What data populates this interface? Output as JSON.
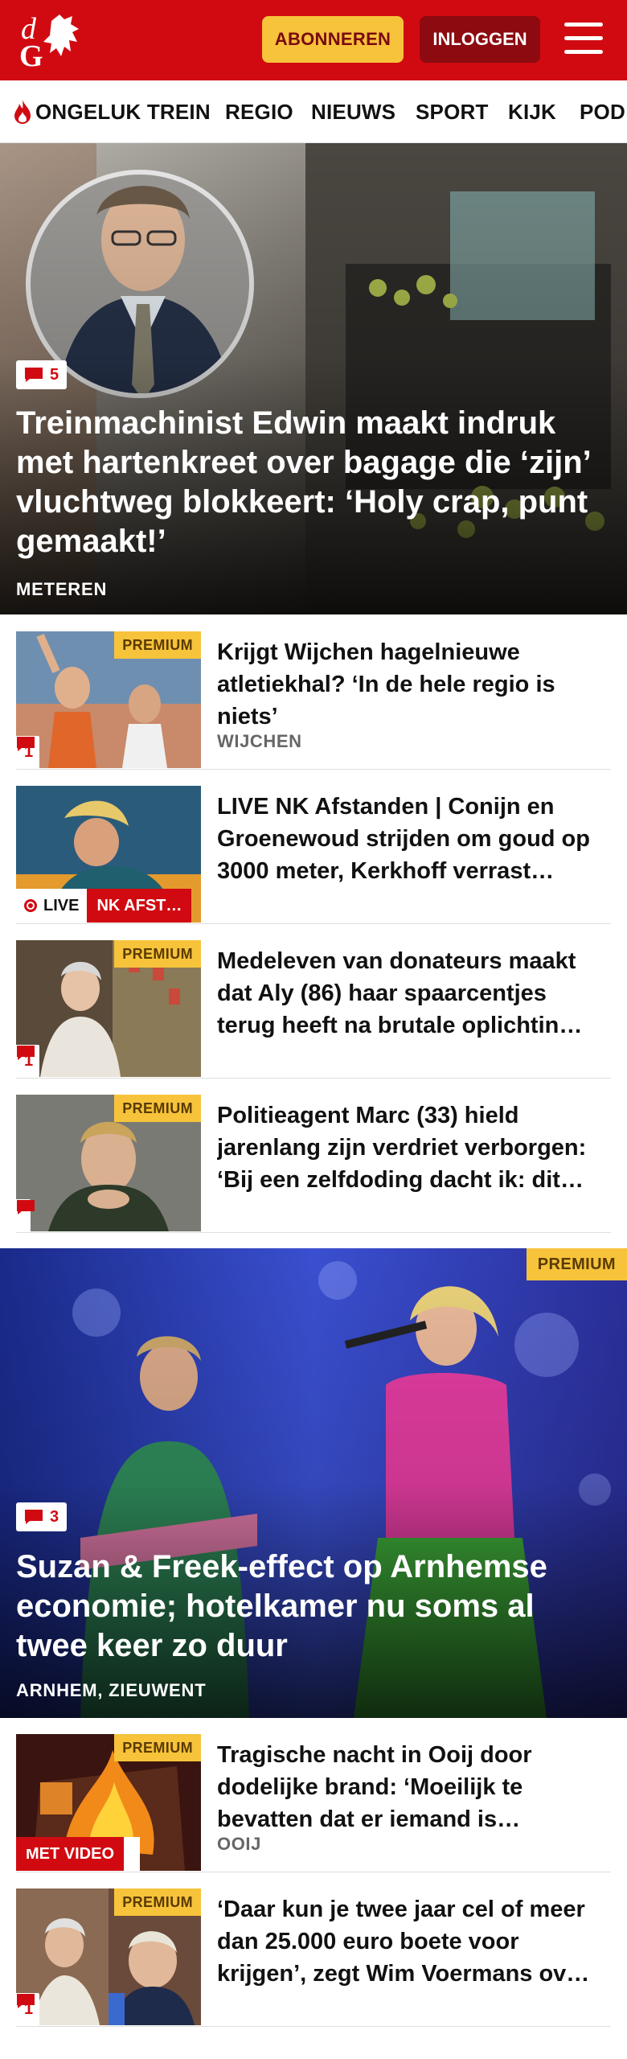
{
  "header": {
    "subscribe_label": "ABONNEREN",
    "login_label": "INLOGGEN",
    "brand_color": "#d10a11",
    "accent_color": "#f6c33b"
  },
  "nav": {
    "items": [
      "ONGELUK TREIN",
      "REGIO",
      "NIEUWS",
      "SPORT",
      "KIJK",
      "POD"
    ]
  },
  "hero1": {
    "comments": "5",
    "title": "Treinmachinist Edwin maakt indruk met hartenkreet over bagage die ‘zijn’ vluchtweg blokkeert: ‘Holy crap, punt gemaakt!’",
    "location": "METEREN"
  },
  "articles": [
    {
      "title": "Krijgt Wijchen hagelnieuwe atletiekhal? ‘In de hele regio is niets’",
      "location": "WIJCHEN",
      "premium": "PREMIUM",
      "comments": "1"
    },
    {
      "title": "LIVE NK Afstanden | Conijn en Groenewoud strijden om goud op 3000 meter, Kerkhoff verrast…",
      "live_label": "LIVE",
      "live_tag": "NK AFST…"
    },
    {
      "title": "Medeleven van donateurs maakt dat Aly (86) haar spaarcentjes terug heeft na brutale oplichtin…",
      "premium": "PREMIUM",
      "comments": "1"
    },
    {
      "title": "Politieagent Marc (33) hield jarenlang zijn verdriet verborgen: ‘Bij een zelfdoding dacht ik: dit…",
      "premium": "PREMIUM"
    }
  ],
  "hero2": {
    "premium": "PREMIUM",
    "comments": "3",
    "title": "Suzan & Freek-effect op Arnhemse economie; hotelkamer nu soms al twee keer zo duur",
    "location": "ARNHEM, ZIEUWENT"
  },
  "articles2": [
    {
      "title": "Tragische nacht in Ooij door dodelijke brand: ‘Moeilijk te bevatten dat er iemand is…",
      "location": "OOIJ",
      "premium": "PREMIUM",
      "video_label": "MET VIDEO"
    },
    {
      "title": "‘Daar kun je twee jaar cel of meer dan 25.000 euro boete voor krijgen’, zegt Wim Voermans ov…",
      "premium": "PREMIUM",
      "comments": "1"
    }
  ]
}
